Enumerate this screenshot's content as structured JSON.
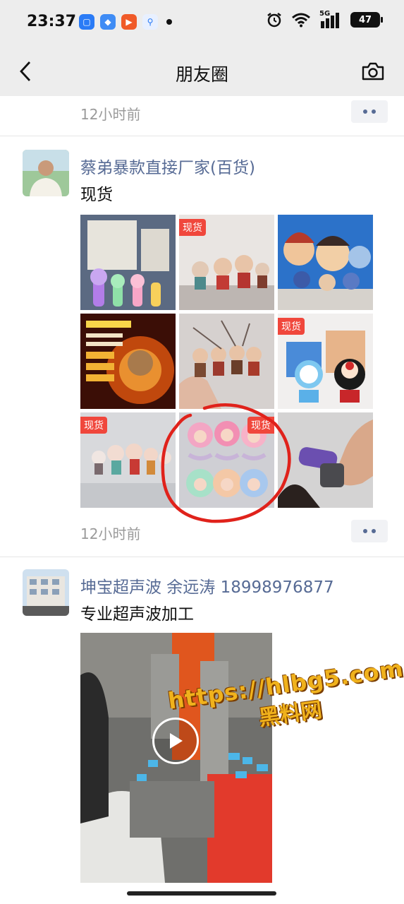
{
  "status_bar": {
    "time": "23:37",
    "network": "5G",
    "battery": "47"
  },
  "nav": {
    "title": "朋友圈"
  },
  "posts": [
    {
      "time": "12小时前"
    },
    {
      "author": "蔡弟暴款直接厂家(百货)",
      "text": "现货",
      "time": "12小时前",
      "photos": [
        {
          "tag": ""
        },
        {
          "tag": "现货"
        },
        {
          "tag": ""
        },
        {
          "tag": ""
        },
        {
          "tag": ""
        },
        {
          "tag": "现货"
        },
        {
          "tag": "现货"
        },
        {
          "tag": "现货"
        },
        {
          "tag": ""
        }
      ]
    },
    {
      "author": "坤宝超声波  余远涛 18998976877",
      "text": "专业超声波加工"
    }
  ],
  "watermark": {
    "url": "https://hlbg5.com",
    "name": "黑料网"
  },
  "colors": {
    "bar_background": "#ededed",
    "author_link": "#576b95",
    "timestamp": "#9a9a9a",
    "tag_red": "#f0473c",
    "annotation_circle": "#e0221b"
  }
}
